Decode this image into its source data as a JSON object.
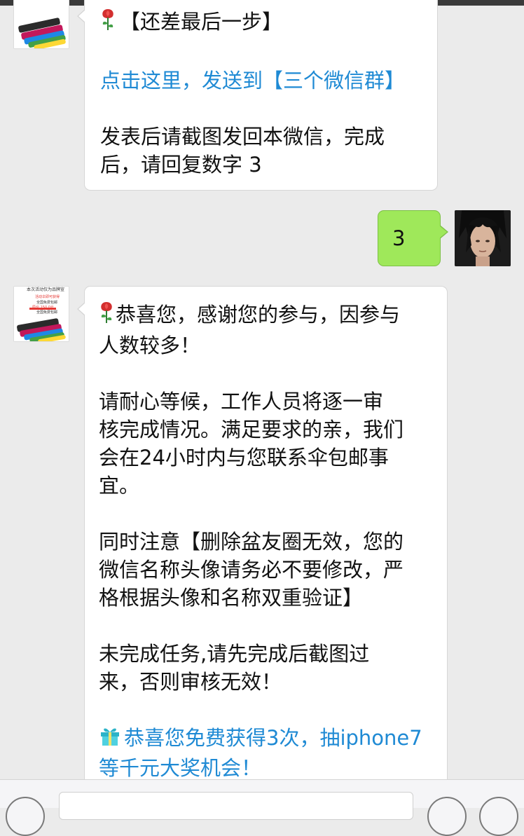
{
  "messages": [
    {
      "sender": "shop",
      "header": "【还差最后一步】",
      "link": "点击这里，发送到【三个微信群】",
      "body_line1": " 发表后请截图发回本微信，完成",
      "body_line2": "后，请回复数字 3"
    },
    {
      "sender": "user",
      "text": "3"
    },
    {
      "sender": "shop",
      "p1_line1": "恭喜您，感谢您的参与，因参与",
      "p1_line2": "人数较多！",
      "p2_line1": "请耐心等候，工作人员将逐一审",
      "p2_line2": "核完成情况。满足要求的亲，我们",
      "p2_line3": "会在24小时内与您联系伞包邮事",
      "p2_line4": "宜。",
      "p3_line1": "同时注意【删除盆友圈无效，您的",
      "p3_line2": "微信名称头像请务必不要修改，严",
      "p3_line3": "格根据头像和名称双重验证】",
      "p4_line1": "未完成任务,请先完成后截图过",
      "p4_line2": "来，否则审核无效！",
      "p5_line1": "恭喜您免费获得3次，抽iphone7",
      "p5_line2": "等千元大奖机会！"
    }
  ],
  "shop_avatar": {
    "line1": "本次活动仅为品牌宣",
    "line2": "活动伞即可获得",
    "line3": "全国免费包邮",
    "line4": "原价 150.0元",
    "line5": "全国免费包邮"
  },
  "icons": {
    "rose": "rose-icon",
    "gift": "gift-icon",
    "voice": "voice-icon",
    "emoji": "emoji-icon",
    "plus": "plus-icon"
  },
  "colors": {
    "link": "#1f8ad4",
    "bubble_sent": "#9fe85a",
    "background": "#ebebeb"
  }
}
